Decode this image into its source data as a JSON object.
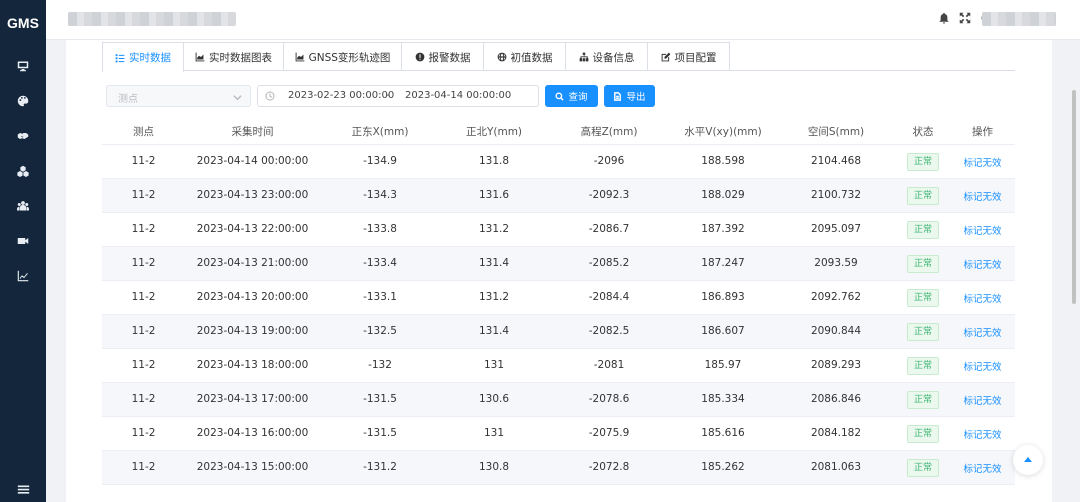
{
  "app": {
    "logo": "GMS"
  },
  "sidebar": {
    "items": [
      {
        "icon": "monitor-icon"
      },
      {
        "icon": "palette-icon"
      },
      {
        "icon": "handshake-icon"
      },
      {
        "icon": "cubes-icon"
      },
      {
        "icon": "group-icon"
      },
      {
        "icon": "video-icon"
      },
      {
        "icon": "line-chart-icon"
      }
    ],
    "bottom_icon": "menu-icon"
  },
  "header": {
    "icons": [
      "bell-icon",
      "fullscreen-icon",
      "refresh-icon"
    ]
  },
  "tabs": [
    {
      "label": "实时数据",
      "icon": "list-icon",
      "active": true
    },
    {
      "label": "实时数据图表",
      "icon": "area-chart-icon",
      "active": false
    },
    {
      "label": "GNSS变形轨迹图",
      "icon": "area-chart-icon",
      "active": false
    },
    {
      "label": "报警数据",
      "icon": "alert-icon",
      "active": false
    },
    {
      "label": "初值数据",
      "icon": "globe-icon",
      "active": false
    },
    {
      "label": "设备信息",
      "icon": "sitemap-icon",
      "active": false
    },
    {
      "label": "项目配置",
      "icon": "edit-icon",
      "active": false
    }
  ],
  "filters": {
    "point_placeholder": "测点",
    "start_date": "2023-02-23 00:00:00",
    "separator": "-",
    "end_date": "2023-04-14 00:00:00",
    "query_label": "查询",
    "export_label": "导出"
  },
  "table": {
    "columns": [
      "测点",
      "采集时间",
      "正东X(mm)",
      "正北Y(mm)",
      "高程Z(mm)",
      "水平V(xy)(mm)",
      "空间S(mm)",
      "状态",
      "操作"
    ],
    "rows": [
      [
        "11-2",
        "2023-04-14 00:00:00",
        "-134.9",
        "131.8",
        "-2096",
        "188.598",
        "2104.468",
        "正常",
        "标记无效"
      ],
      [
        "11-2",
        "2023-04-13 23:00:00",
        "-134.3",
        "131.6",
        "-2092.3",
        "188.029",
        "2100.732",
        "正常",
        "标记无效"
      ],
      [
        "11-2",
        "2023-04-13 22:00:00",
        "-133.8",
        "131.2",
        "-2086.7",
        "187.392",
        "2095.097",
        "正常",
        "标记无效"
      ],
      [
        "11-2",
        "2023-04-13 21:00:00",
        "-133.4",
        "131.4",
        "-2085.2",
        "187.247",
        "2093.59",
        "正常",
        "标记无效"
      ],
      [
        "11-2",
        "2023-04-13 20:00:00",
        "-133.1",
        "131.2",
        "-2084.4",
        "186.893",
        "2092.762",
        "正常",
        "标记无效"
      ],
      [
        "11-2",
        "2023-04-13 19:00:00",
        "-132.5",
        "131.4",
        "-2082.5",
        "186.607",
        "2090.844",
        "正常",
        "标记无效"
      ],
      [
        "11-2",
        "2023-04-13 18:00:00",
        "-132",
        "131",
        "-2081",
        "185.97",
        "2089.293",
        "正常",
        "标记无效"
      ],
      [
        "11-2",
        "2023-04-13 17:00:00",
        "-131.5",
        "130.6",
        "-2078.6",
        "185.334",
        "2086.846",
        "正常",
        "标记无效"
      ],
      [
        "11-2",
        "2023-04-13 16:00:00",
        "-131.5",
        "131",
        "-2075.9",
        "185.616",
        "2084.182",
        "正常",
        "标记无效"
      ],
      [
        "11-2",
        "2023-04-13 15:00:00",
        "-131.2",
        "130.8",
        "-2072.8",
        "185.262",
        "2081.063",
        "正常",
        "标记无效"
      ]
    ]
  },
  "colors": {
    "primary": "#1890ff",
    "sidebar": "#13263b",
    "status_ok": "#3cb371"
  }
}
